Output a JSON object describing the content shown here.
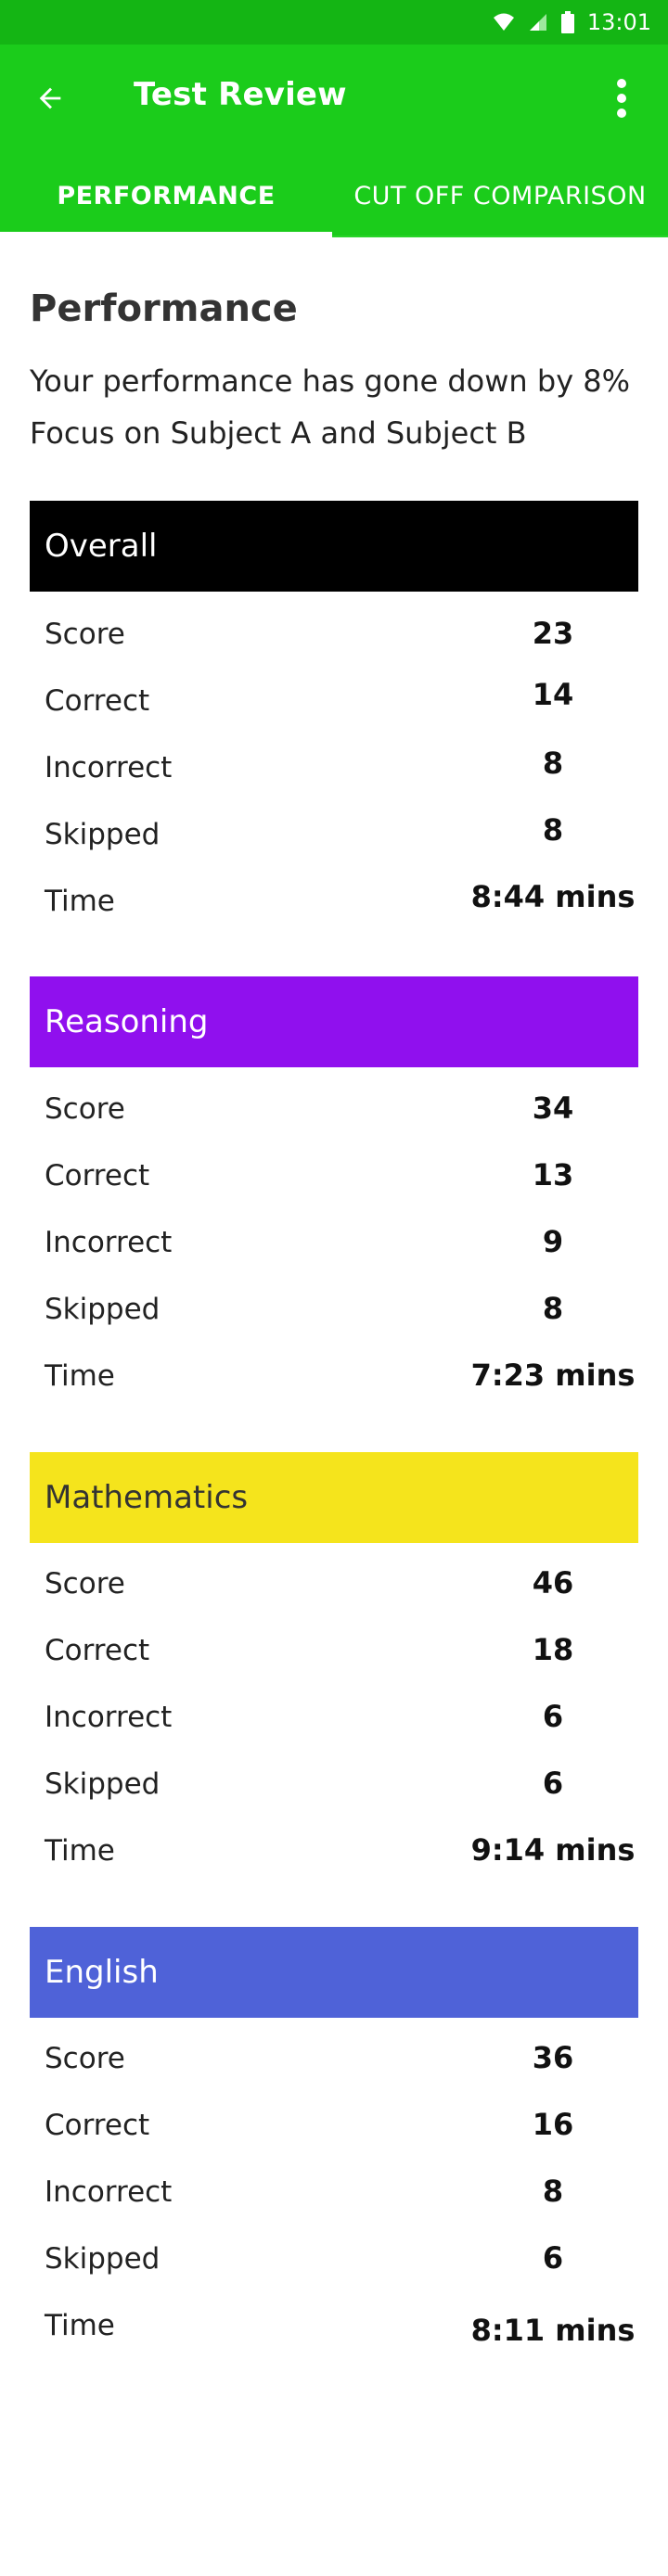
{
  "status_bar": {
    "time": "13:01",
    "icons": [
      "wifi-icon",
      "signal-icon",
      "battery-icon"
    ]
  },
  "app_bar": {
    "title": "Test Review",
    "back_icon": "arrow-back-icon",
    "menu_icon": "more-vert-icon"
  },
  "tabs": [
    {
      "label": "PERFORMANCE",
      "active": true
    },
    {
      "label": "CUT OFF COMPARISON",
      "active": false
    }
  ],
  "performance": {
    "title": "Performance",
    "message_line1": "Your performance has gone down by 8%",
    "message_line2": "Focus on Subject A and Subject B"
  },
  "sections": [
    {
      "name": "Overall",
      "color": "#000000",
      "text_color": "#ffffff",
      "rows": [
        {
          "label": "Score",
          "value": "23"
        },
        {
          "label": "Correct",
          "value": "14"
        },
        {
          "label": "Incorrect",
          "value": "8"
        },
        {
          "label": "Skipped",
          "value": "8"
        },
        {
          "label": "Time",
          "value": "8:44 mins"
        }
      ]
    },
    {
      "name": "Reasoning",
      "color": "#9010ee",
      "text_color": "#ffffff",
      "rows": [
        {
          "label": "Score",
          "value": "34"
        },
        {
          "label": "Correct",
          "value": "13"
        },
        {
          "label": "Incorrect",
          "value": "9"
        },
        {
          "label": "Skipped",
          "value": "8"
        },
        {
          "label": "Time",
          "value": "7:23 mins"
        }
      ]
    },
    {
      "name": "Mathematics",
      "color": "#f5e41c",
      "text_color": "#333333",
      "rows": [
        {
          "label": "Score",
          "value": "46"
        },
        {
          "label": "Correct",
          "value": "18"
        },
        {
          "label": "Incorrect",
          "value": "6"
        },
        {
          "label": "Skipped",
          "value": "6"
        },
        {
          "label": "Time",
          "value": "9:14 mins"
        }
      ]
    },
    {
      "name": "English",
      "color": "#4f62d8",
      "text_color": "#ffffff",
      "rows": [
        {
          "label": "Score",
          "value": "36"
        },
        {
          "label": "Correct",
          "value": "16"
        },
        {
          "label": "Incorrect",
          "value": "8"
        },
        {
          "label": "Skipped",
          "value": "6"
        },
        {
          "label": "Time",
          "value": "8:11 mins"
        }
      ]
    }
  ]
}
